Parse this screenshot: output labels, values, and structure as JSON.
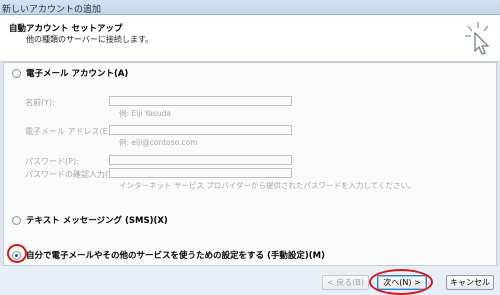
{
  "window": {
    "title": "新しいアカウントの追加"
  },
  "header": {
    "title": "自動アカウント セットアップ",
    "subtitle": "他の種類のサーバーに接続します。"
  },
  "email_account": {
    "label": "電子メール アカウント(A)",
    "selected": false,
    "name_label": "名前(Y):",
    "name_hint": "例: Eiji Yasuda",
    "email_label": "電子メール アドレス(E):",
    "email_hint": "例: eiji@contoso.com",
    "password_label": "パスワード(P):",
    "password_confirm_label": "パスワードの確認入力(T):",
    "password_hint": "インターネット サービス プロバイダーから提供されたパスワードを入力してください。"
  },
  "sms_option": {
    "label": "テキスト メッセージング (SMS)(X)",
    "selected": false
  },
  "manual_option": {
    "label": "自分で電子メールやその他のサービスを使うための設定をする (手動設定)(M)",
    "selected": true
  },
  "buttons": {
    "back": "< 戻る(B)",
    "next": "次へ(N) >",
    "cancel": "キャンセル"
  },
  "colors": {
    "annotation": "#d11a1a",
    "accent": "#2c5a9a"
  }
}
